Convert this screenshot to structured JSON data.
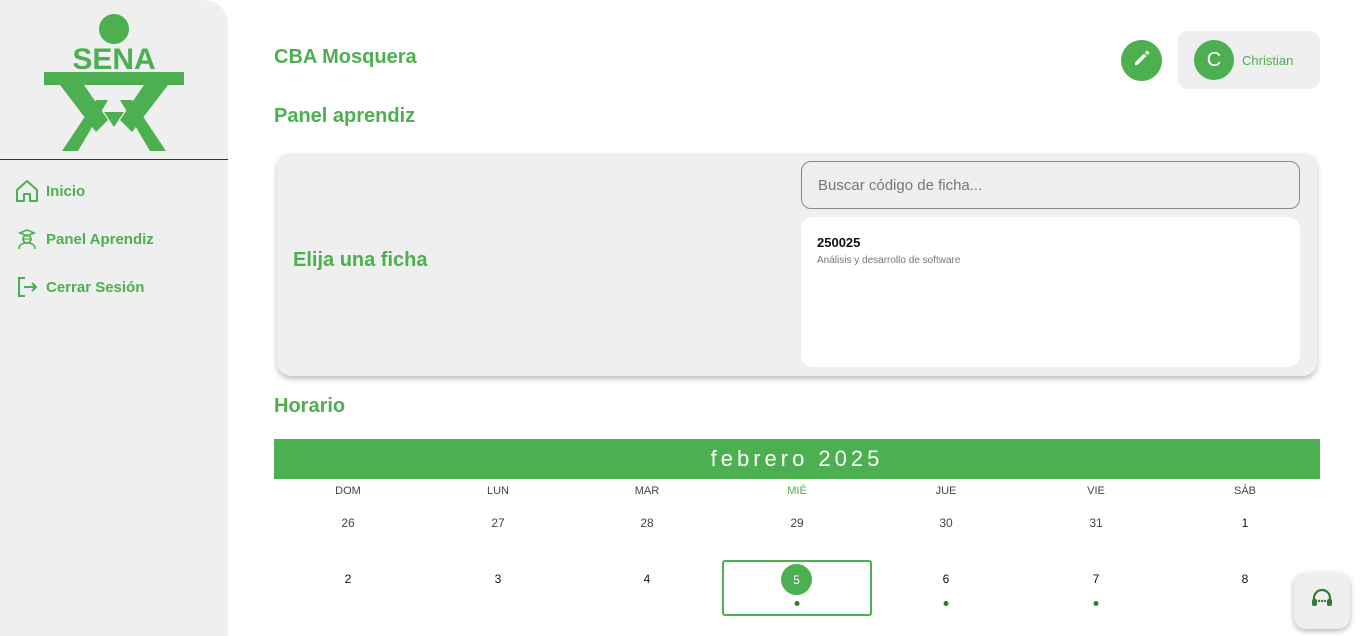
{
  "brand": {
    "logo_text": "SENA",
    "accent": "#4caf50"
  },
  "sidebar": {
    "items": [
      {
        "label": "Inicio",
        "icon": "home-icon"
      },
      {
        "label": "Panel Aprendiz",
        "icon": "student-icon"
      },
      {
        "label": "Cerrar Sesión",
        "icon": "logout-icon"
      }
    ]
  },
  "header": {
    "center": "CBA Mosquera",
    "subtitle": "Panel aprendiz"
  },
  "user": {
    "initial": "C",
    "name": "Christian"
  },
  "panel": {
    "title": "Elija una ficha",
    "search_placeholder": "Buscar código de ficha...",
    "fichas": [
      {
        "code": "250025",
        "program": "Análisis y desarrollo de software"
      }
    ]
  },
  "schedule": {
    "title": "Horario",
    "month_label": "febrero 2025",
    "weekdays": [
      "DOM",
      "LUN",
      "MAR",
      "MIÉ",
      "JUE",
      "VIE",
      "SÁB"
    ],
    "active_weekday": "MIÉ",
    "weeks": [
      [
        "26",
        "27",
        "28",
        "29",
        "30",
        "31",
        "1"
      ],
      [
        "2",
        "3",
        "4",
        "5",
        "6",
        "7",
        "8"
      ]
    ],
    "today": "5",
    "event_days": [
      "5",
      "6",
      "7"
    ]
  }
}
